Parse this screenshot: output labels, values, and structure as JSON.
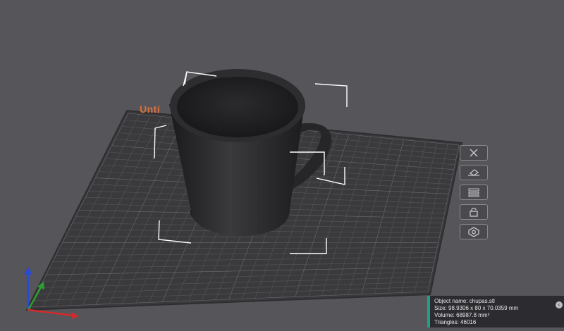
{
  "plate": {
    "label": "Unti"
  },
  "toolbar": {
    "items": [
      {
        "name": "delete",
        "icon": "close-icon"
      },
      {
        "name": "auto-orient",
        "icon": "layflat-icon"
      },
      {
        "name": "arrange",
        "icon": "arrange-icon"
      },
      {
        "name": "lock",
        "icon": "lock-icon"
      },
      {
        "name": "settings",
        "icon": "gear-icon"
      }
    ]
  },
  "object_info": {
    "name": "Object name: chupas.stl",
    "size": "Size: 98.9306 x 80 x 70.0359 mm",
    "volume": "Volume: 68987.8 mm³",
    "triangles": "Triangles: 46016"
  },
  "colors": {
    "background": "#55555a",
    "bed": "#3a3a3d",
    "accent": "#1ea08c",
    "plate_label": "#e0703a",
    "axis_x": "#d42a2a",
    "axis_y": "#2ca02c",
    "axis_z": "#2a4ad4"
  }
}
